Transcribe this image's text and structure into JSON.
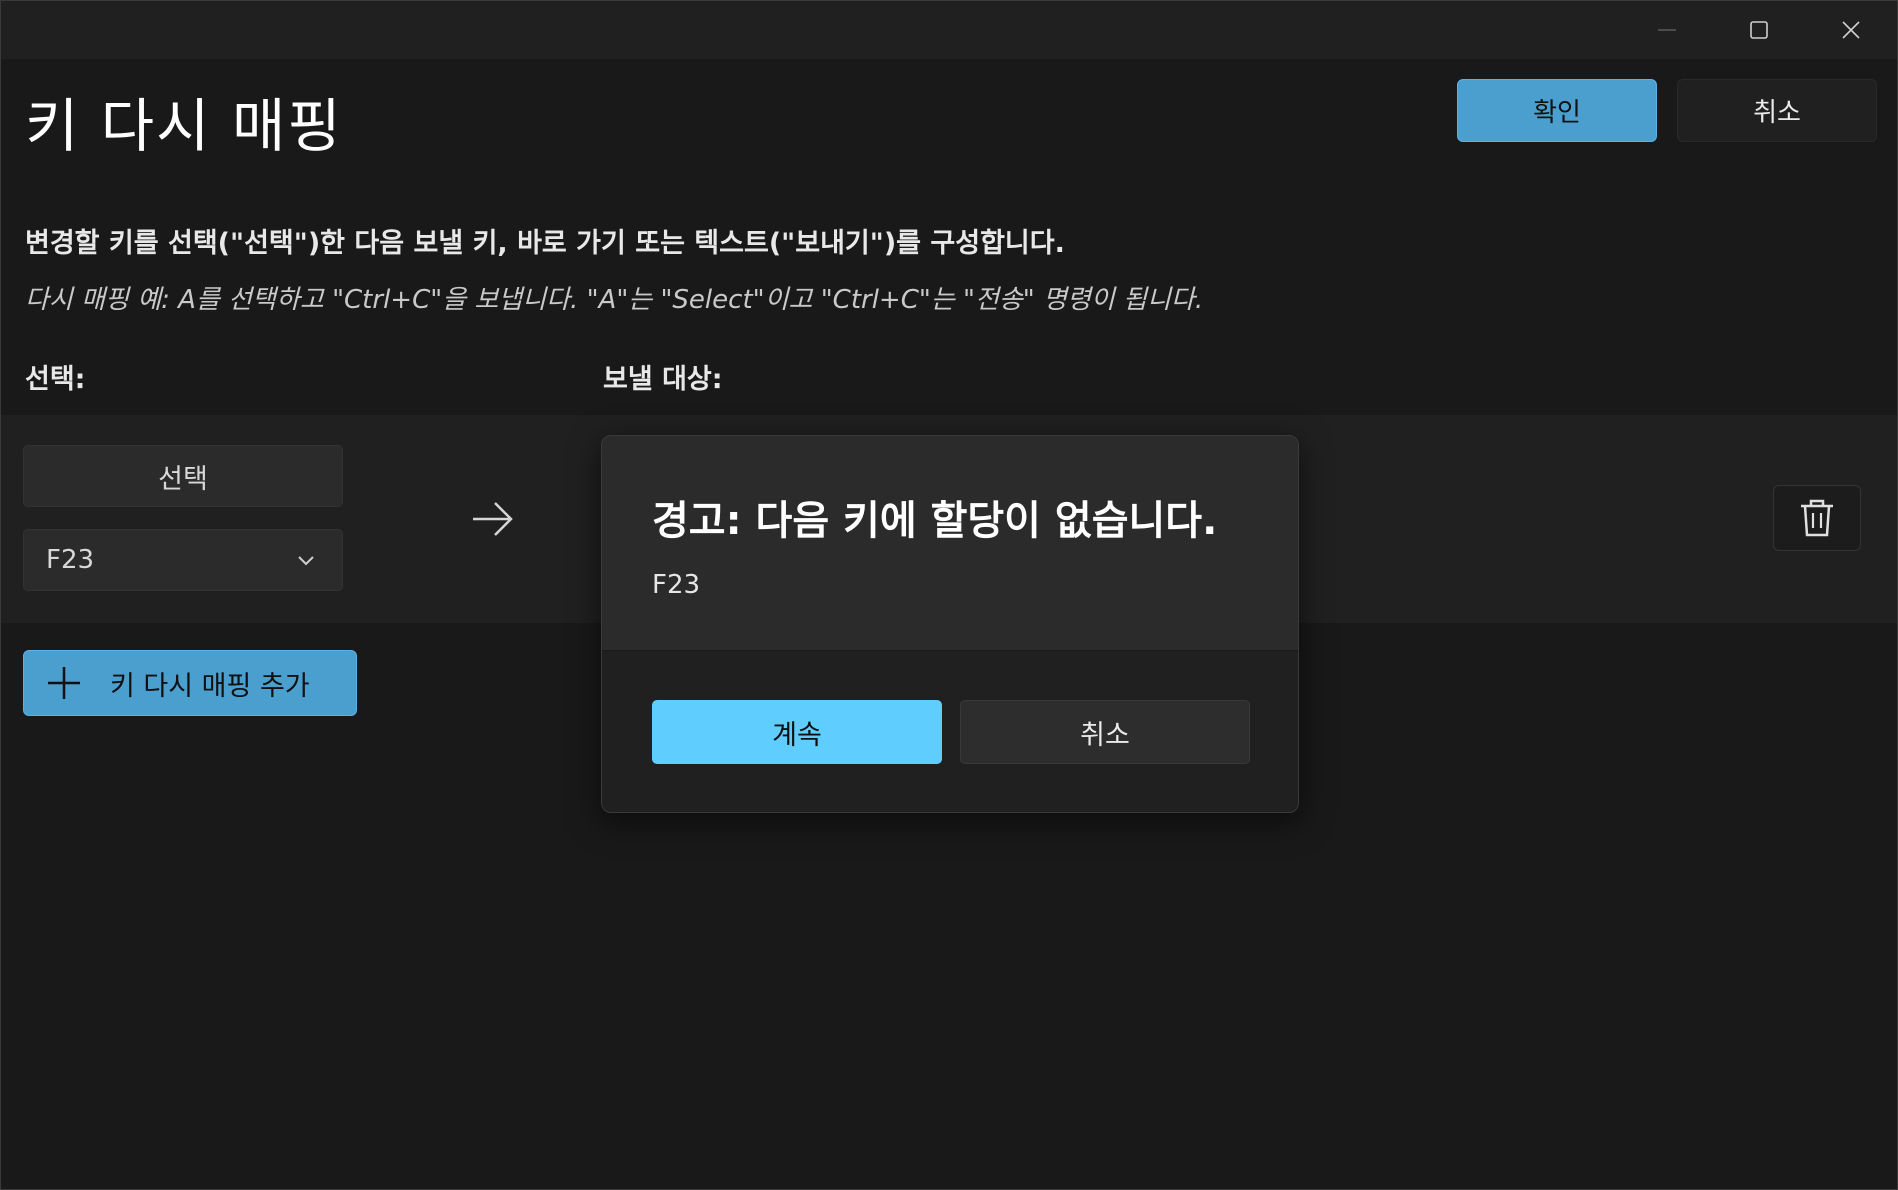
{
  "window": {
    "title": "키 다시 매핑",
    "caption_buttons": [
      "minimize-icon",
      "maximize-icon",
      "close-icon"
    ]
  },
  "header": {
    "ok_label": "확인",
    "cancel_label": "취소"
  },
  "main": {
    "description": "변경할 키를 선택(\"선택\")한 다음 보낼 키, 바로 가기 또는 텍스트(\"보내기\")를 구성합니다.",
    "example": "다시 매핑 예: A를 선택하고 \"Ctrl+C\"을 보냅니다. \"A\"는 \"Select\"이고 \"Ctrl+C\"는 \"전송\" 명령이 됩니다.",
    "select_column_label": "선택:",
    "target_column_label": "보낼 대상:",
    "mapping_row": {
      "select_button_label": "선택",
      "selected_key": "F23",
      "arrow_icon": "arrow-right-icon",
      "delete_icon": "trash-icon"
    },
    "add_button_label": "키 다시 매핑 추가"
  },
  "dialog": {
    "title": "경고: 다음 키에 할당이 없습니다.",
    "content": "F23",
    "continue_label": "계속",
    "cancel_label": "취소"
  },
  "colors": {
    "accent": "#4a9fcf",
    "dialog_primary": "#60cdff",
    "background": "#191919"
  }
}
